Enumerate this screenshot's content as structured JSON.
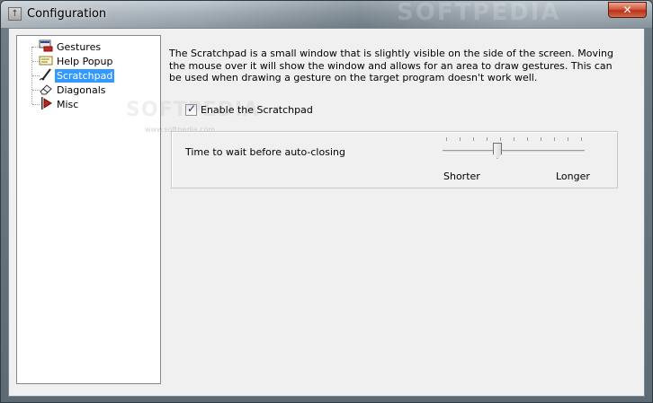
{
  "window": {
    "title": "Configuration",
    "close_glyph": "✕",
    "app_icon": "arrow-up-icon"
  },
  "watermark": {
    "top": "SOFTPEDIA",
    "mid": "SOFTPEDIA",
    "url": "www.softpedia.com"
  },
  "sidebar": {
    "selected": "Scratchpad",
    "items": [
      {
        "label": "Gestures",
        "icon": "gestures-icon"
      },
      {
        "label": "Help Popup",
        "icon": "help-popup-icon"
      },
      {
        "label": "Scratchpad",
        "icon": "pencil-icon"
      },
      {
        "label": "Diagonals",
        "icon": "eraser-icon"
      },
      {
        "label": "Misc",
        "icon": "misc-icon"
      }
    ]
  },
  "content": {
    "description": "The Scratchpad is a small window that  is slightly visible on the side of the screen. Moving the mouse over it will show the window and allows for an area to draw gestures. This can be used when drawing a gesture on the target program doesn't work well.",
    "enable_checkbox": {
      "label": "Enable the Scratchpad",
      "checked": true,
      "glyph": "✓"
    },
    "auto_close": {
      "label": "Time to wait before auto-closing",
      "min_label": "Shorter",
      "max_label": "Longer",
      "value_fraction": 0.38
    }
  }
}
